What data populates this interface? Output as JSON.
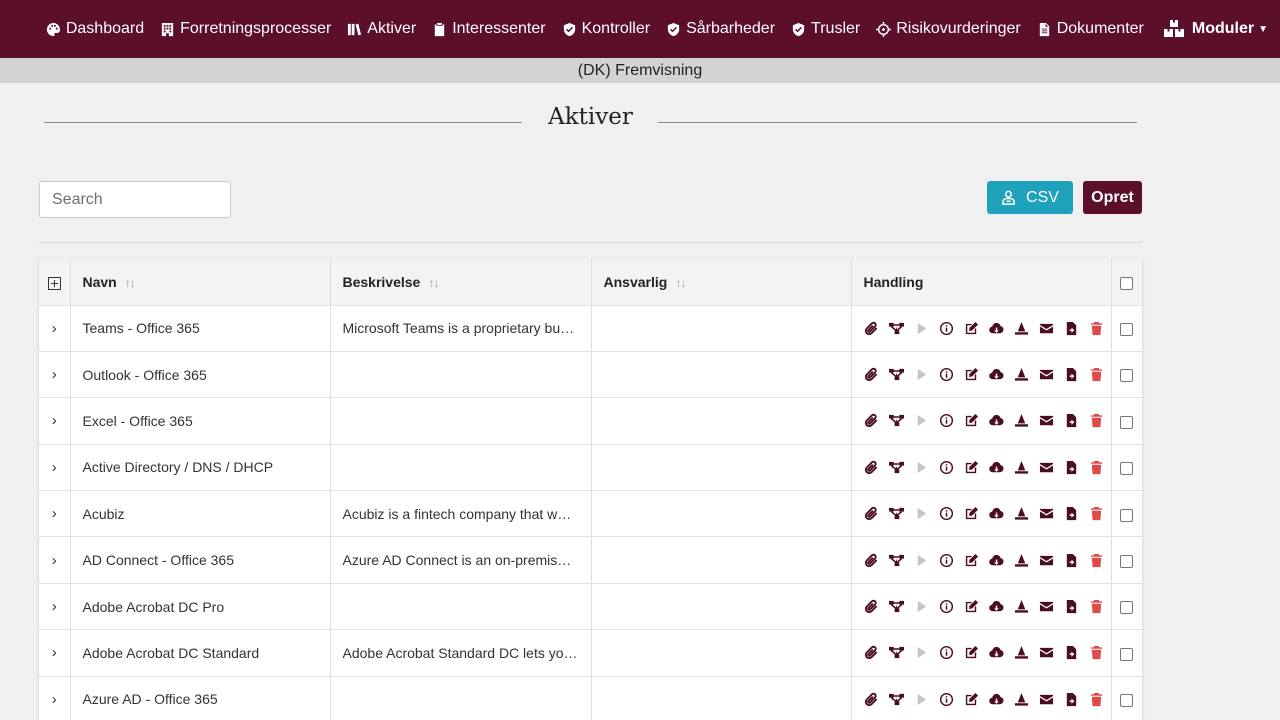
{
  "nav": {
    "items": [
      {
        "label": "Dashboard",
        "icon": "palette-icon"
      },
      {
        "label": "Forretningsprocesser",
        "icon": "building-icon"
      },
      {
        "label": "Aktiver",
        "icon": "books-icon"
      },
      {
        "label": "Interessenter",
        "icon": "clipboard-icon"
      },
      {
        "label": "Kontroller",
        "icon": "shield-check-icon"
      },
      {
        "label": "Sårbarheder",
        "icon": "shield-check-icon"
      },
      {
        "label": "Trusler",
        "icon": "shield-check-icon"
      },
      {
        "label": "Risikovurderinger",
        "icon": "crosshairs-icon"
      },
      {
        "label": "Dokumenter",
        "icon": "document-icon"
      }
    ],
    "modules_label": "Moduler"
  },
  "preview_label": "(DK) Fremvisning",
  "page_title": "Aktiver",
  "search": {
    "placeholder": "Search"
  },
  "buttons": {
    "csv": "CSV",
    "create": "Opret"
  },
  "table": {
    "columns": {
      "name": "Navn",
      "description": "Beskrivelse",
      "responsible": "Ansvarlig",
      "actions": "Handling"
    },
    "sort_glyph": "↑↓",
    "expand_glyph": "›",
    "rows": [
      {
        "name": "Teams - Office 365",
        "description": "Microsoft Teams is a proprietary bu…",
        "responsible": ""
      },
      {
        "name": "Outlook - Office 365",
        "description": "",
        "responsible": ""
      },
      {
        "name": "Excel - Office 365",
        "description": "",
        "responsible": ""
      },
      {
        "name": "Active Directory / DNS / DHCP",
        "description": "",
        "responsible": ""
      },
      {
        "name": "Acubiz",
        "description": "Acubiz is a fintech company that w…",
        "responsible": ""
      },
      {
        "name": "AD Connect - Office 365",
        "description": "Azure AD Connect is an on-premise…",
        "responsible": ""
      },
      {
        "name": "Adobe Acrobat DC Pro",
        "description": "",
        "responsible": ""
      },
      {
        "name": "Adobe Acrobat DC Standard",
        "description": "Adobe Acrobat Standard DC lets yo…",
        "responsible": ""
      },
      {
        "name": "Azure AD - Office 365",
        "description": "",
        "responsible": ""
      }
    ],
    "action_icons": [
      "paperclip-icon",
      "network-icon",
      "play-icon",
      "info-icon",
      "edit-icon",
      "cloud-download-icon",
      "wizard-hat-icon",
      "envelope-icon",
      "file-export-icon",
      "trash-icon"
    ]
  },
  "colors": {
    "brand": "#5c0f2a",
    "csv_button": "#1fa3bd",
    "delete": "#e04a4a",
    "preview_bar": "#d3d3d3"
  }
}
